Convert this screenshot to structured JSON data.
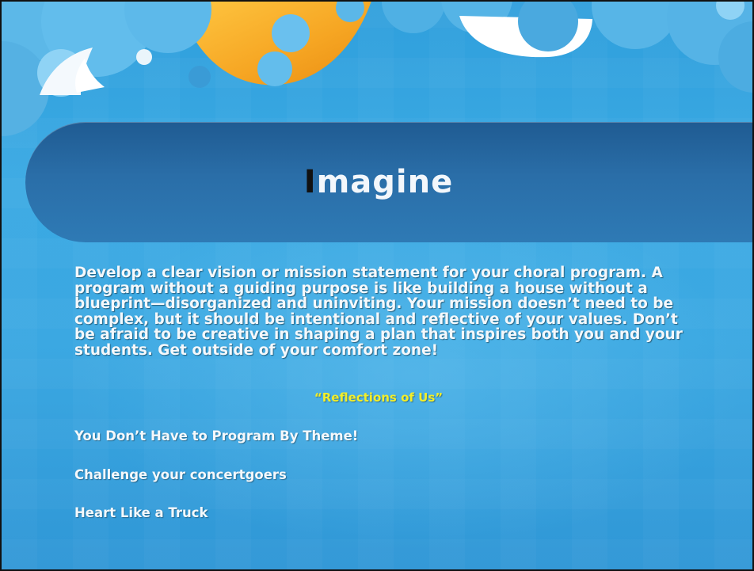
{
  "slide": {
    "title_initial": "I",
    "title_rest": "magine",
    "body": "Develop a clear vision or mission statement for your choral program. A program without a guiding purpose is like building a house without a blueprint—disorganized and uninviting. Your mission doesn’t need to be complex, but it should be intentional and reflective of your values. Don’t be afraid to be creative in shaping a plan that inspires both you and your students. Get outside of your comfort zone!",
    "highlight": "“Reflections of Us”",
    "bullets": [
      "You Don’t Have to Program By Theme!",
      "Challenge your concertgoers",
      "Heart Like a Truck"
    ]
  },
  "colors": {
    "background": "#3aa9e3",
    "title_band": "#2a6ea8",
    "highlight_text": "#f2ee2a",
    "moon": "#f6a623",
    "cloud": "#5dbbec"
  },
  "decor": {
    "top_graphic": "cloud-and-moon-illustration"
  }
}
